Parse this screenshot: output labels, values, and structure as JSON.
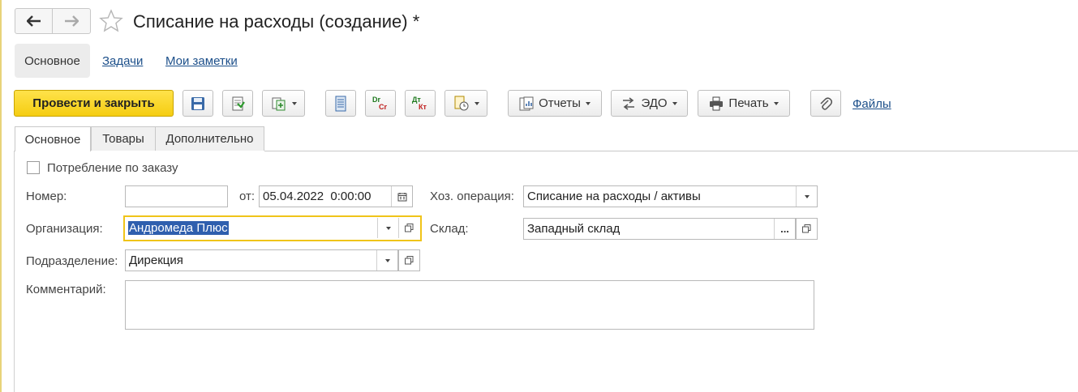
{
  "window": {
    "title": "Списание на расходы (создание) *"
  },
  "sections": {
    "main": "Основное",
    "tasks": "Задачи",
    "notes": "Мои заметки"
  },
  "toolbar": {
    "post_close": "Провести и закрыть",
    "reports": "Отчеты",
    "edo": "ЭДО",
    "print": "Печать",
    "files": "Файлы",
    "dtkt_top": "Dr",
    "dtkt_bottom": "Cr",
    "dtkt2_top": "Дт",
    "dtkt2_bottom": "Кт"
  },
  "tabs": [
    {
      "label": "Основное",
      "active": true
    },
    {
      "label": "Товары",
      "active": false
    },
    {
      "label": "Дополнительно",
      "active": false
    }
  ],
  "form": {
    "consumption_label": "Потребление по заказу",
    "consumption_checked": false,
    "number_label": "Номер:",
    "number_value": "",
    "date_label": "от:",
    "date_value": "05.04.2022  0:00:00",
    "operation_label": "Хоз. операция:",
    "operation_value": "Списание на расходы / активы",
    "org_label": "Организация:",
    "org_value": "Андромеда Плюс",
    "warehouse_label": "Склад:",
    "warehouse_value": "Западный склад",
    "warehouse_btn": "...",
    "dept_label": "Подразделение:",
    "dept_value": "Дирекция",
    "comment_label": "Комментарий:",
    "comment_value": ""
  },
  "colors": {
    "accent_yellow": "#f5cd12",
    "link_blue": "#1c4f8a",
    "focus_border": "#f0c419",
    "selection": "#2f5fae"
  }
}
